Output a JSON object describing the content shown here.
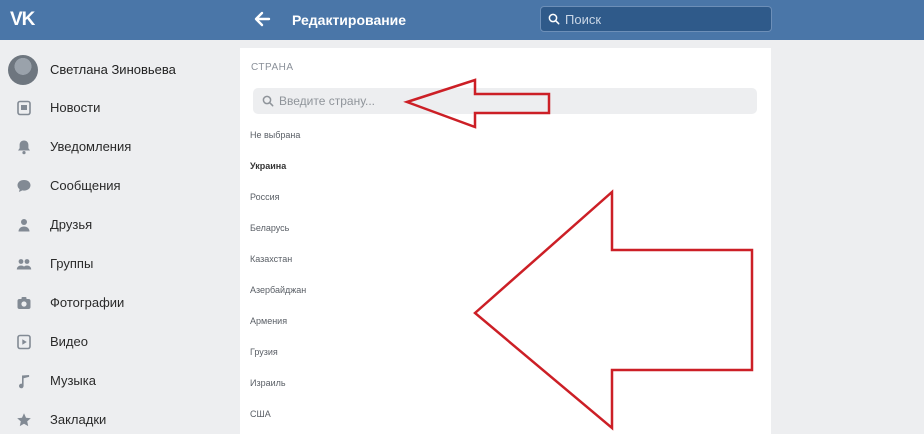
{
  "header": {
    "logo_text": "VK",
    "title": "Редактирование",
    "search_placeholder": "Поиск",
    "brand_color": "#4a76a8"
  },
  "sidebar": {
    "profile_name": "Светлана Зиновьева",
    "items": [
      {
        "label": "Новости",
        "icon": "news-icon"
      },
      {
        "label": "Уведомления",
        "icon": "bell-icon"
      },
      {
        "label": "Сообщения",
        "icon": "message-icon"
      },
      {
        "label": "Друзья",
        "icon": "friends-icon"
      },
      {
        "label": "Группы",
        "icon": "groups-icon"
      },
      {
        "label": "Фотографии",
        "icon": "camera-icon"
      },
      {
        "label": "Видео",
        "icon": "video-icon"
      },
      {
        "label": "Музыка",
        "icon": "music-icon"
      },
      {
        "label": "Закладки",
        "icon": "star-icon"
      }
    ]
  },
  "main": {
    "section_label": "СТРАНА",
    "country_search_placeholder": "Введите страну...",
    "options": [
      "Не выбрана",
      "Украина",
      "Россия",
      "Беларусь",
      "Казахстан",
      "Азербайджан",
      "Армения",
      "Грузия",
      "Израиль",
      "США"
    ],
    "selected_index": 1
  },
  "annotation_color": "#cc1f26"
}
